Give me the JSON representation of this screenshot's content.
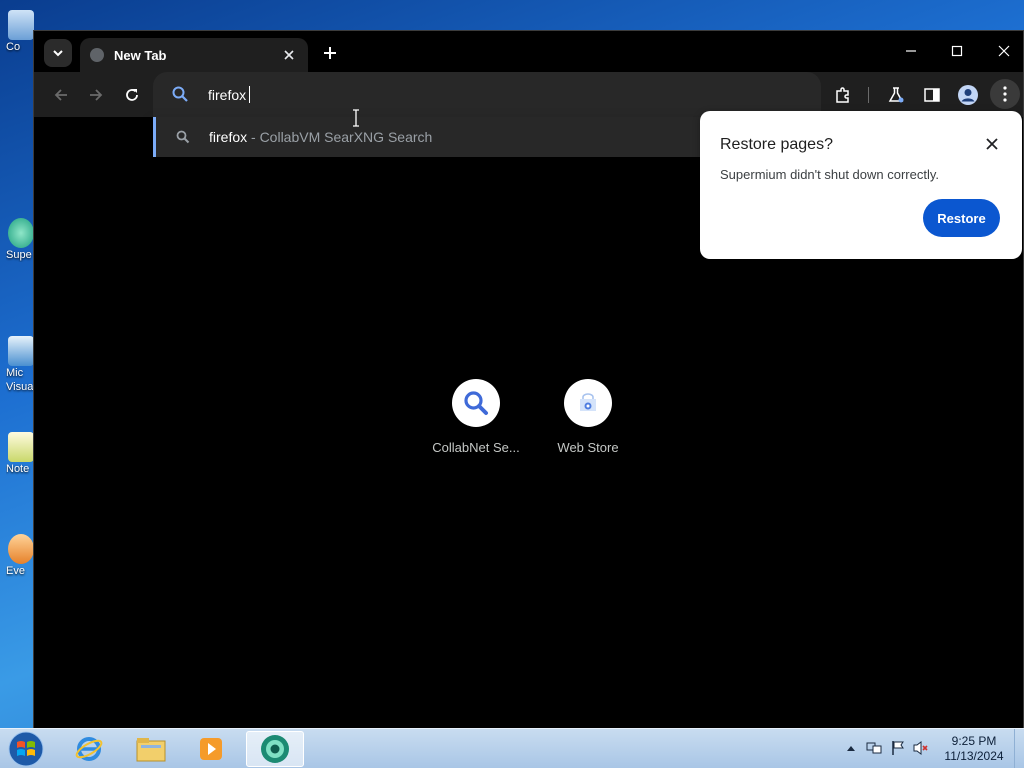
{
  "desktop": {
    "icons": [
      {
        "label": "Co"
      },
      {
        "label": "Supe"
      },
      {
        "label": "Mic Visua"
      },
      {
        "label": "Note"
      },
      {
        "label": "Eve"
      }
    ]
  },
  "browser": {
    "tab": {
      "title": "New Tab"
    },
    "omnibox": {
      "value": "firefox"
    },
    "suggestion": {
      "query": "firefox",
      "description": " - CollabVM SearXNG Search"
    },
    "shortcuts": [
      {
        "label": "CollabNet Se...",
        "icon": "search-icon"
      },
      {
        "label": "Web Store",
        "icon": "web-store-icon"
      }
    ],
    "restore_bubble": {
      "title": "Restore pages?",
      "message": "Supermium didn't shut down correctly.",
      "button": "Restore"
    }
  },
  "taskbar": {
    "clock_time": "9:25 PM",
    "clock_date": "11/13/2024",
    "apps": [
      "internet-explorer-icon",
      "file-explorer-icon",
      "media-player-icon",
      "supermium-icon"
    ]
  },
  "colors": {
    "accent": "#0b57d0",
    "omnibox_bg": "#282828",
    "toolbar_bg": "#1f1f1f",
    "suggestion_highlight": "#7cacf8"
  }
}
